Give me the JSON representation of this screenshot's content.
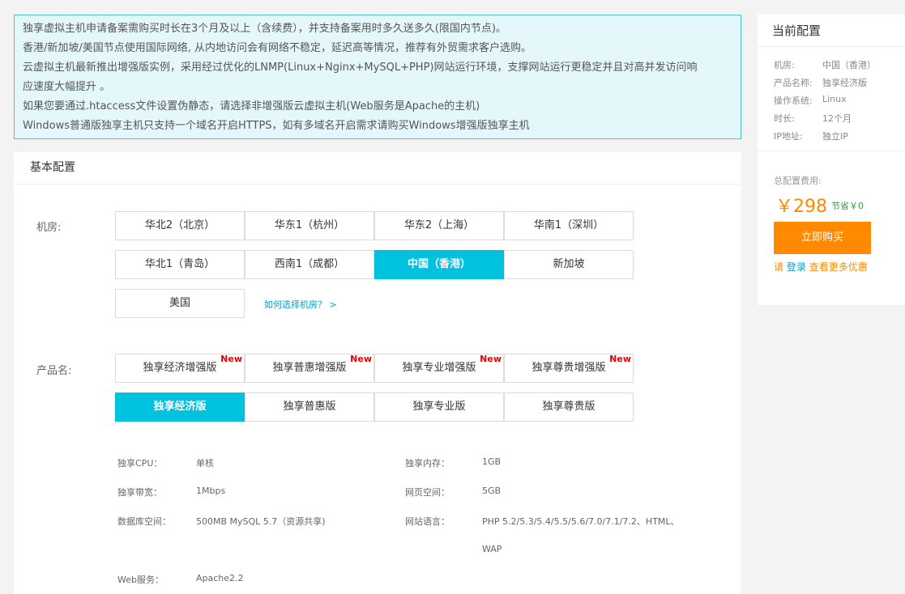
{
  "notice": {
    "lines": [
      "独享虚拟主机申请备案需购买时长在3个月及以上（含续费），并支持备案用时多久送多久(限国内节点)。",
      "香港/新加坡/美国节点使用国际网络, 从内地访问会有网络不稳定，延迟高等情况，推荐有外贸需求客户选购。",
      "云虚拟主机最新推出增强版实例，采用经过优化的LNMP(Linux+Nginx+MySQL+PHP)网站运行环境，支撑网站运行更稳定并且对高并发访问响",
      "应速度大幅提升 。",
      "如果您要通过.htaccess文件设置伪静态，请选择非增强版云虚拟主机(Web服务是Apache的主机)",
      "Windows普通版独享主机只支持一个域名开启HTTPS，如有多域名开启需求请购买Windows增强版独享主机"
    ]
  },
  "basic_config": {
    "title": "基本配置",
    "datacenter_label": "机房:",
    "datacenters": [
      "华北2（北京）",
      "华东1（杭州）",
      "华东2（上海）",
      "华南1（深圳）",
      "华北1（青岛）",
      "西南1（成都）",
      "中国（香港）",
      "新加坡",
      "美国"
    ],
    "datacenter_selected": "中国（香港）",
    "datacenter_help": "如何选择机房？ >",
    "product_label": "产品名:",
    "products_enhanced": [
      "独享经济增强版",
      "独享普惠增强版",
      "独享专业增强版",
      "独享尊贵增强版"
    ],
    "new_badge": "New",
    "products": [
      "独享经济版",
      "独享普惠版",
      "独享专业版",
      "独享尊贵版"
    ],
    "product_selected": "独享经济版",
    "specs": {
      "cpu_label": "独享CPU：",
      "cpu": "单核",
      "memory_label": "独享内存：",
      "memory": "1GB",
      "bandwidth_label": "独享带宽：",
      "bandwidth": "1Mbps",
      "webspace_label": "网页空间：",
      "webspace": "5GB",
      "db_label": "数据库空间：",
      "db": "500MB MySQL 5.7（资源共享)",
      "lang_label": "网站语言：",
      "lang_1": "PHP 5.2/5.3/5.4/5.5/5.6/7.0/7.1/7.2、HTML、",
      "lang_2": "WAP",
      "web_label": "Web服务：",
      "web": "Apache2.2"
    }
  },
  "side": {
    "title": "当前配置",
    "rows": [
      {
        "label": "机房:",
        "value": "中国（香港）"
      },
      {
        "label": "产品名称:",
        "value": "独享经济版"
      },
      {
        "label": "操作系统:",
        "value": "Linux"
      },
      {
        "label": "时长:",
        "value": "12个月"
      },
      {
        "label": "IP地址:",
        "value": "独立IP"
      }
    ],
    "total_label": "总配置费用:",
    "price": "￥298",
    "save": "节省￥0",
    "buy_label": "立即购买",
    "login_prefix": "请",
    "login_link": "登录",
    "login_suffix": "查看更多优惠"
  },
  "colors": {
    "accent": "#00c1de",
    "orange": "#ff8a00",
    "new_red": "#e60000",
    "notice_border": "#45c4dc"
  }
}
